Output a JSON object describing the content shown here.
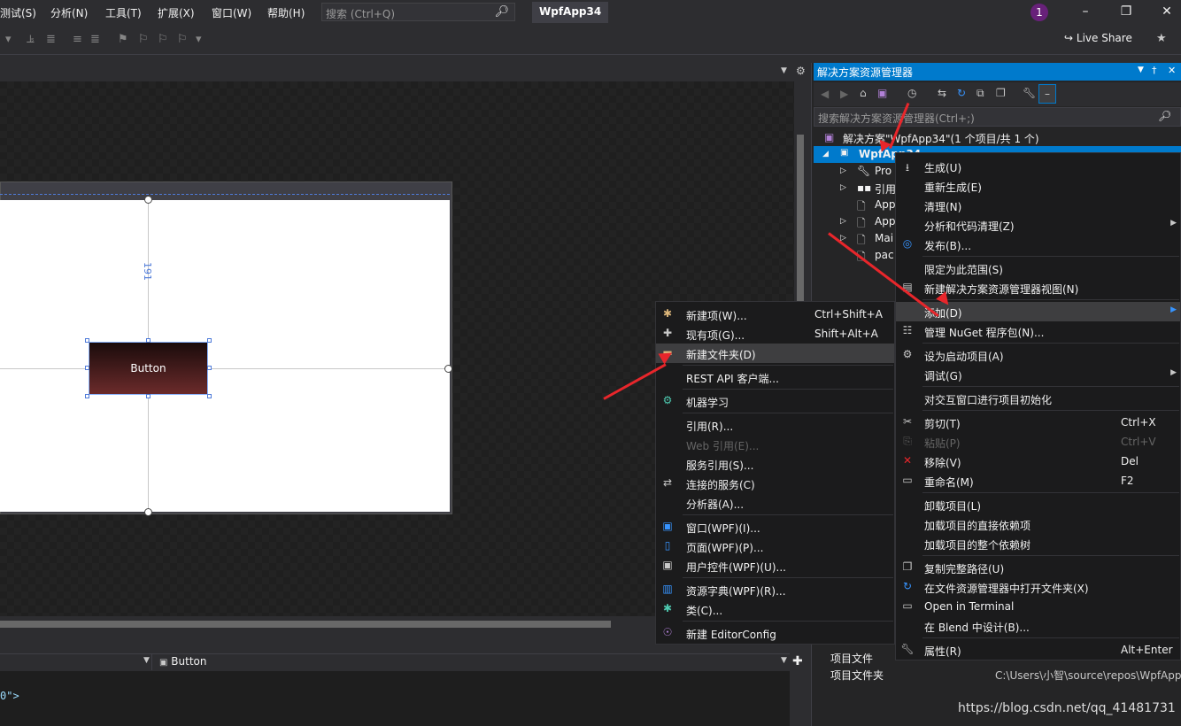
{
  "menubar": {
    "items": [
      "测试(S)",
      "分析(N)",
      "工具(T)",
      "扩展(X)",
      "窗口(W)",
      "帮助(H)"
    ],
    "search_placeholder": "搜索 (Ctrl+Q)",
    "app_title": "WpfApp34",
    "notification_count": "1"
  },
  "toolbar": {
    "live_share": "Live Share"
  },
  "designer": {
    "dimension_label": "191",
    "button_text": "Button"
  },
  "xaml": {
    "element_combo": "Button",
    "code_fragment": "0\">"
  },
  "solution_explorer": {
    "title": "解决方案资源管理器",
    "search_placeholder": "搜索解决方案资源管理器(Ctrl+;)",
    "solution_row": "解决方案\"WpfApp34\"(1 个项目/共 1 个)",
    "project_row": "WpfApp34",
    "children": [
      "Pro",
      "引用",
      "App",
      "App",
      "Mai",
      "pac"
    ],
    "properties": [
      {
        "name": "项目文件",
        "value": ""
      },
      {
        "name": "项目文件夹",
        "value": "C:\\Users\\小智\\source\\repos\\WpfApp"
      }
    ]
  },
  "project_menu": {
    "items": [
      {
        "icon": "build-icon",
        "label": "生成(U)",
        "shortcut": ""
      },
      {
        "icon": "",
        "label": "重新生成(E)",
        "shortcut": ""
      },
      {
        "icon": "",
        "label": "清理(N)",
        "shortcut": ""
      },
      {
        "icon": "",
        "label": "分析和代码清理(Z)",
        "shortcut": ""
      },
      {
        "icon": "globe-icon",
        "label": "发布(B)...",
        "shortcut": ""
      },
      {
        "icon": "",
        "label": "限定为此范围(S)",
        "shortcut": ""
      },
      {
        "icon": "new-view-icon",
        "label": "新建解决方案资源管理器视图(N)",
        "shortcut": ""
      },
      {
        "icon": "",
        "label": "添加(D)",
        "shortcut": ""
      },
      {
        "icon": "nuget-icon",
        "label": "管理 NuGet 程序包(N)...",
        "shortcut": ""
      },
      {
        "icon": "gear-icon",
        "label": "设为启动项目(A)",
        "shortcut": ""
      },
      {
        "icon": "",
        "label": "调试(G)",
        "shortcut": ""
      },
      {
        "icon": "",
        "label": "对交互窗口进行项目初始化",
        "shortcut": ""
      },
      {
        "icon": "cut-icon",
        "label": "剪切(T)",
        "shortcut": "Ctrl+X"
      },
      {
        "icon": "paste-icon",
        "label": "粘贴(P)",
        "shortcut": "Ctrl+V"
      },
      {
        "icon": "delete-icon",
        "label": "移除(V)",
        "shortcut": "Del"
      },
      {
        "icon": "rename-icon",
        "label": "重命名(M)",
        "shortcut": "F2"
      },
      {
        "icon": "",
        "label": "卸载项目(L)",
        "shortcut": ""
      },
      {
        "icon": "",
        "label": "加载项目的直接依赖项",
        "shortcut": ""
      },
      {
        "icon": "",
        "label": "加载项目的整个依赖树",
        "shortcut": ""
      },
      {
        "icon": "copy-icon",
        "label": "复制完整路径(U)",
        "shortcut": ""
      },
      {
        "icon": "refresh-icon",
        "label": "在文件资源管理器中打开文件夹(X)",
        "shortcut": ""
      },
      {
        "icon": "terminal-icon",
        "label": "Open in Terminal",
        "shortcut": ""
      },
      {
        "icon": "",
        "label": "在 Blend 中设计(B)...",
        "shortcut": ""
      },
      {
        "icon": "wrench-icon",
        "label": "属性(R)",
        "shortcut": "Alt+Enter"
      }
    ]
  },
  "add_submenu": {
    "items": [
      {
        "icon": "new-item-icon",
        "label": "新建项(W)...",
        "shortcut": "Ctrl+Shift+A"
      },
      {
        "icon": "existing-item-icon",
        "label": "现有项(G)...",
        "shortcut": "Shift+Alt+A"
      },
      {
        "icon": "new-folder-icon",
        "label": "新建文件夹(D)",
        "shortcut": ""
      },
      {
        "icon": "",
        "label": "REST API 客户端...",
        "shortcut": ""
      },
      {
        "icon": "ml-icon",
        "label": "机器学习",
        "shortcut": ""
      },
      {
        "icon": "",
        "label": "引用(R)...",
        "shortcut": ""
      },
      {
        "icon": "",
        "label": "Web 引用(E)...",
        "shortcut": ""
      },
      {
        "icon": "",
        "label": "服务引用(S)...",
        "shortcut": ""
      },
      {
        "icon": "connected-service-icon",
        "label": "连接的服务(C)",
        "shortcut": ""
      },
      {
        "icon": "",
        "label": "分析器(A)...",
        "shortcut": ""
      },
      {
        "icon": "window-icon",
        "label": "窗口(WPF)(I)...",
        "shortcut": ""
      },
      {
        "icon": "page-icon",
        "label": "页面(WPF)(P)...",
        "shortcut": ""
      },
      {
        "icon": "user-control-icon",
        "label": "用户控件(WPF)(U)...",
        "shortcut": ""
      },
      {
        "icon": "resource-dictionary-icon",
        "label": "资源字典(WPF)(R)...",
        "shortcut": ""
      },
      {
        "icon": "class-icon",
        "label": "类(C)...",
        "shortcut": ""
      },
      {
        "icon": "editorconfig-icon",
        "label": "新建 EditorConfig",
        "shortcut": ""
      }
    ]
  },
  "watermark": "https://blog.csdn.net/qq_41481731",
  "colors": {
    "accent": "#007acc",
    "annotation": "#e8262b",
    "menu_bg": "#1b1b1c"
  }
}
